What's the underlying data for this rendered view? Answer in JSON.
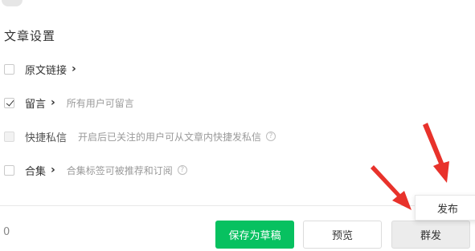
{
  "section_title": "文章设置",
  "settings": [
    {
      "label": "原文链接",
      "chevron": "›",
      "description": "",
      "checked": false,
      "disabled": false,
      "help": false
    },
    {
      "label": "留言",
      "chevron": "›",
      "description": "所有用户可留言",
      "checked": true,
      "disabled": false,
      "help": false
    },
    {
      "label": "快捷私信",
      "chevron": "",
      "description": "开启后已关注的用户可从文章内快捷发私信",
      "checked": false,
      "disabled": true,
      "help": true
    },
    {
      "label": "合集",
      "chevron": "›",
      "description": "合集标签可被推荐和订阅",
      "checked": false,
      "disabled": false,
      "help": true
    }
  ],
  "footer": {
    "count": "0",
    "save_draft_label": "保存为草稿",
    "preview_label": "预览",
    "mass_send_label": "群发",
    "publish_label": "发布"
  },
  "help_glyph": "?",
  "colors": {
    "primary_green": "#07c160",
    "arrow_red": "#e8322b"
  }
}
